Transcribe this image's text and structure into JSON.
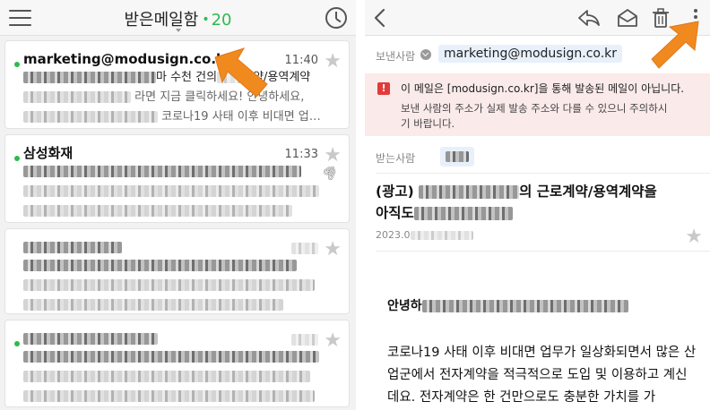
{
  "colors": {
    "accent_green": "#2dbb4e",
    "arrow_orange": "#f08a1e",
    "warning_red": "#e23b3b",
    "warning_bg": "#fbeaea",
    "chip_bg": "#e8f0fb"
  },
  "inbox": {
    "title": "받은메일함",
    "separator_dot": "•",
    "unread_count": "20",
    "menu_icon": "hamburger-icon",
    "recent_icon": "clock-icon",
    "mails": [
      {
        "sender": "marketing@modusign.co.kr",
        "time": "11:40",
        "subject_visible": "마 수천 건의",
        "subject_tail": "약/용역계약",
        "preview1_visible": "라면 지금 클릭하세요! 안녕하세요,",
        "preview2_visible": "코로나19 사태 이후 비대면 업…",
        "unread": true
      },
      {
        "sender": "삼성화재",
        "time": "11:33",
        "has_attachment": true,
        "unread": true
      },
      {
        "sender": "",
        "time": "",
        "unread": false
      },
      {
        "sender": "",
        "time": "",
        "unread": true
      }
    ]
  },
  "detail": {
    "back_icon": "chevron-left-icon",
    "reply_icon": "reply-icon",
    "mark_read_icon": "envelope-open-icon",
    "delete_icon": "trash-icon",
    "more_icon": "more-vertical-icon",
    "from_label": "보낸사람",
    "from_address": "marketing@modusign.co.kr",
    "warning_title": "이 메일은 [modusign.co.kr]을 통해 발송된 메일이 아닙니다.",
    "warning_desc": "보낸 사람의 주소가 실제 발송 주소와 다를 수 있으니 주의하시기 바랍니다.",
    "to_label": "받는사람",
    "subject_prefix": "(광고)",
    "subject_mid": "의 근로계약/용역계약을",
    "subject_line2_start": "아직도",
    "date_prefix": "2023.0",
    "greeting_prefix": "안녕하",
    "body": "코로나19 사태 이후 비대면 업무가 일상화되면서 많은 산업군에서 전자계약을 적극적으로 도입 및 이용하고 계신데요. 전자계약은 한 건만으로도 충분한 가치를 가"
  }
}
